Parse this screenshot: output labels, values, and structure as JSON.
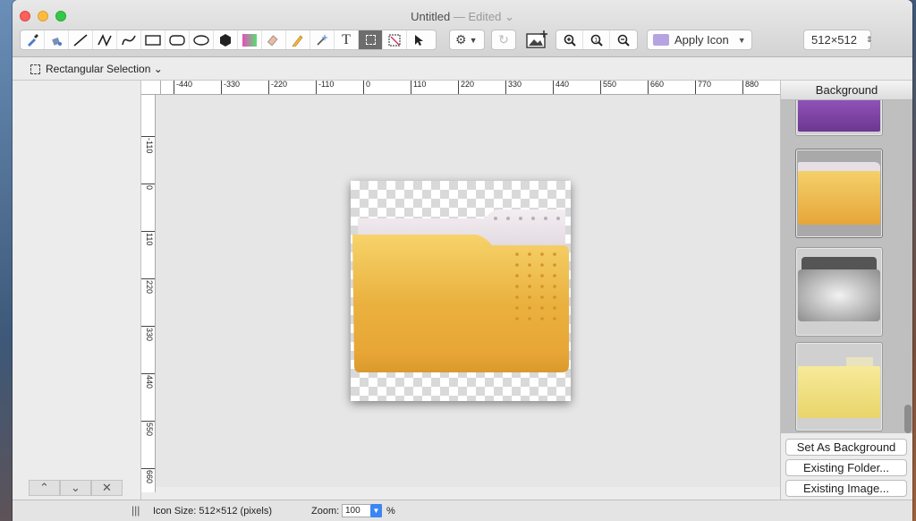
{
  "window": {
    "title": "Untitled",
    "subtitle": "— Edited ⌄"
  },
  "toolbar": {
    "tools": [
      {
        "name": "eyedropper-tool-icon"
      },
      {
        "name": "paint-bucket-tool-icon"
      },
      {
        "name": "line-tool-icon"
      },
      {
        "name": "polyline-tool-icon"
      },
      {
        "name": "curve-tool-icon"
      },
      {
        "name": "rectangle-tool-icon"
      },
      {
        "name": "rounded-rectangle-tool-icon"
      },
      {
        "name": "ellipse-tool-icon"
      },
      {
        "name": "polygon-tool-icon"
      },
      {
        "name": "gradient-tool-icon"
      },
      {
        "name": "eraser-tool-icon"
      },
      {
        "name": "pencil-tool-icon"
      },
      {
        "name": "magic-wand-tool-icon"
      },
      {
        "name": "text-tool-icon",
        "glyph": "T"
      },
      {
        "name": "rectangular-selection-tool-icon",
        "active": true
      },
      {
        "name": "crop-tool-icon"
      },
      {
        "name": "pointer-tool-icon"
      }
    ],
    "apply_icon_label": "Apply Icon",
    "size_value": "512×512",
    "zoom_in_label": "+",
    "zoom_actual_label": "1",
    "zoom_out_label": "−"
  },
  "options": {
    "selection_mode": "Rectangular Selection ⌄"
  },
  "ruler": {
    "h_labels": [
      "-440",
      "-330",
      "-220",
      "-110",
      "0",
      "110",
      "220",
      "330",
      "440",
      "550",
      "660",
      "770",
      "880"
    ],
    "v_labels": [
      "-110",
      "0",
      "110",
      "220",
      "330",
      "440",
      "550",
      "660"
    ]
  },
  "sidebar": {
    "header": "Background",
    "buttons": {
      "set_background": "Set As Background",
      "existing_folder": "Existing Folder...",
      "existing_image": "Existing Image..."
    }
  },
  "left_nav": {
    "up": "⌃",
    "down": "⌄",
    "delete": "✕"
  },
  "status": {
    "icon_size": "Icon Size: 512×512 (pixels)",
    "zoom_label": "Zoom:",
    "zoom_value": "100",
    "zoom_unit": "%"
  },
  "colors": {
    "folder_yellow": "#f0b53c",
    "folder_purple": "#8b4fb3",
    "accent_blue": "#3b86f5"
  }
}
